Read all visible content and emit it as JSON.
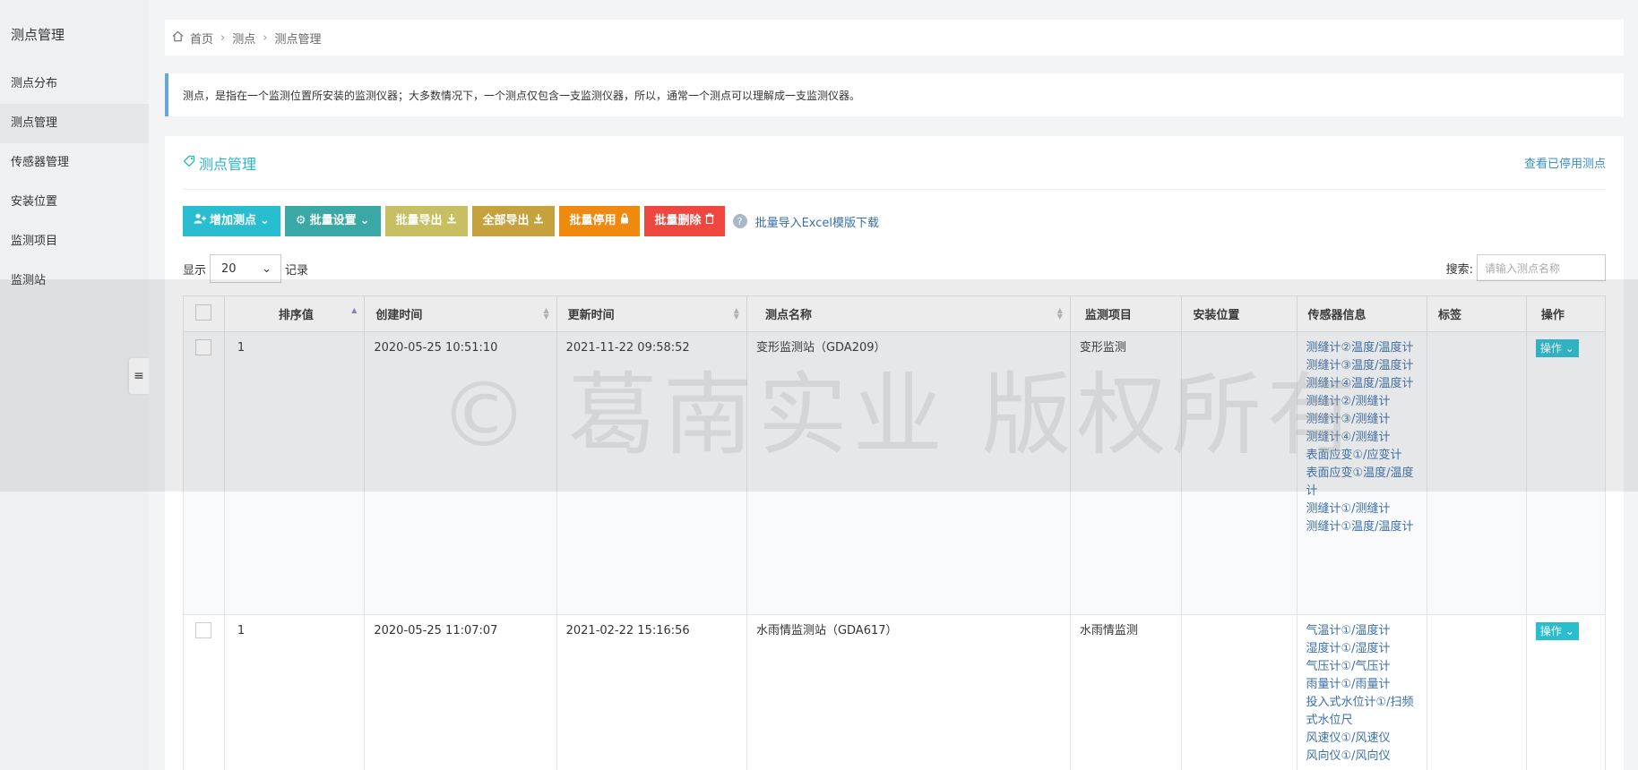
{
  "sidebar": {
    "title": "测点管理",
    "items": [
      {
        "label": "测点分布"
      },
      {
        "label": "测点管理"
      },
      {
        "label": "传感器管理"
      },
      {
        "label": "安装位置"
      },
      {
        "label": "监测项目"
      },
      {
        "label": "监测站"
      }
    ]
  },
  "breadcrumb": {
    "home": "首页",
    "level1": "测点",
    "current": "测点管理"
  },
  "info": "测点，是指在一个监测位置所安装的监测仪器；大多数情况下，一个测点仅包含一支监测仪器，所以，通常一个测点可以理解成一支监测仪器。",
  "panel": {
    "title": "测点管理",
    "disabled_link": "查看已停用测点"
  },
  "toolbar": {
    "add": "增加测点",
    "batch_set": "批量设置",
    "batch_export": "批量导出",
    "export_all": "全部导出",
    "batch_disable": "批量停用",
    "batch_delete": "批量删除",
    "import_link": "批量导入Excel模版下载"
  },
  "length": {
    "prefix": "显示",
    "value": "20",
    "suffix": "记录"
  },
  "search": {
    "label": "搜索:",
    "placeholder": "请输入测点名称"
  },
  "table": {
    "headers": [
      "排序值",
      "创建时间",
      "更新时间",
      "测点名称",
      "监测项目",
      "安装位置",
      "传感器信息",
      "标签",
      "操作"
    ],
    "rows": [
      {
        "sort": "1",
        "created": "2020-05-25 10:51:10",
        "updated": "2021-11-22 09:58:52",
        "name": "变形监测站（GDA209）",
        "project": "变形监测",
        "location": "",
        "sensors": [
          "测缝计②温度/温度计",
          "测缝计③温度/温度计",
          "测缝计④温度/温度计",
          "测缝计②/测缝计",
          "测缝计③/测缝计",
          "测缝计④/测缝计",
          "表面应变①/应变计",
          "表面应变①温度/温度计",
          "测缝计①/测缝计",
          "测缝计①温度/温度计"
        ],
        "tag": "",
        "ops": "操作"
      },
      {
        "sort": "1",
        "created": "2020-05-25 11:07:07",
        "updated": "2021-02-22 15:16:56",
        "name": "水雨情监测站（GDA617）",
        "project": "水雨情监测",
        "location": "",
        "sensors": [
          "气温计①/温度计",
          "湿度计①/湿度计",
          "气压计①/气压计",
          "雨量计①/雨量计",
          "投入式水位计①/扫频式水位尺",
          "风速仪①/风速仪",
          "风向仪①/风向仪"
        ],
        "tag": "",
        "ops": "操作"
      }
    ]
  },
  "watermark": "© 葛南实业 版权所有"
}
